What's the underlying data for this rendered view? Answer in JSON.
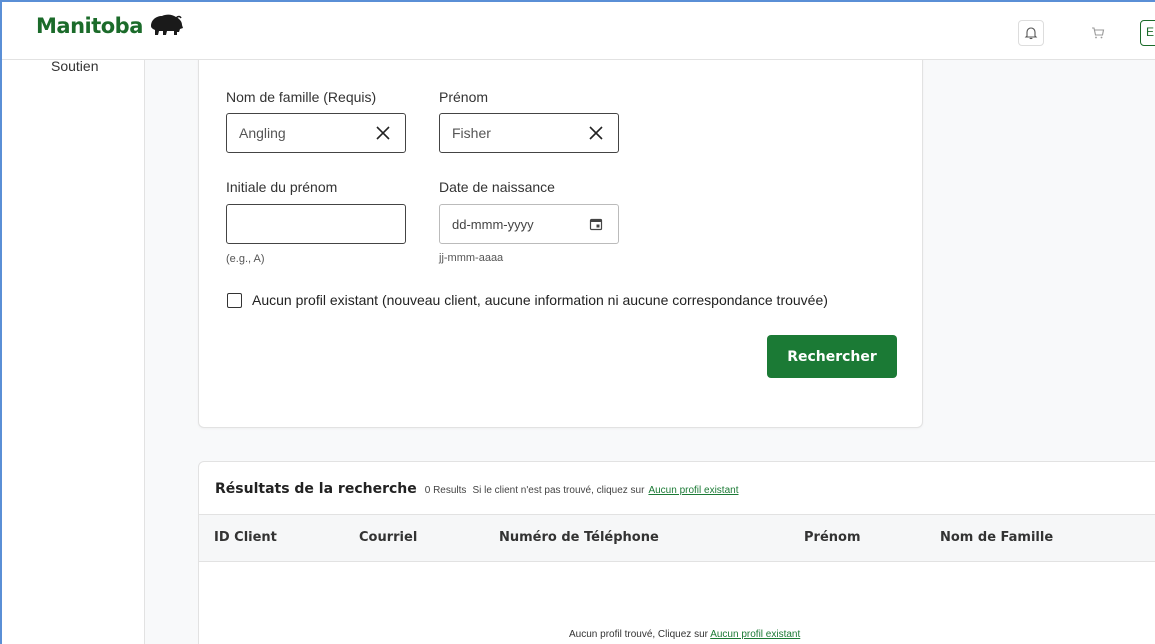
{
  "header": {
    "brand": "Manitoba",
    "lang_label": "E",
    "colors": {
      "brand": "#1b6b2a",
      "accent": "#1b7a35"
    }
  },
  "sidebar": {
    "items": [
      {
        "label": "Soutien"
      }
    ]
  },
  "form": {
    "last_name": {
      "label": "Nom de famille (Requis)",
      "value": "Angling"
    },
    "first_name": {
      "label": "Prénom",
      "value": "Fisher"
    },
    "initial": {
      "label": "Initiale du prénom",
      "value": "",
      "hint": "(e.g., A)"
    },
    "dob": {
      "label": "Date de naissance",
      "placeholder": "dd-mmm-yyyy",
      "hint": "jj-mmm-aaaa"
    },
    "no_profile_checkbox": {
      "label": "Aucun profil existant (nouveau client, aucune information ni aucune correspondance trouvée)",
      "checked": false
    },
    "search_button": "Rechercher"
  },
  "results": {
    "title": "Résultats de la recherche",
    "count": "0 Results",
    "note": "Si le client n'est pas trouvé, cliquez sur",
    "link": "Aucun profil existant",
    "columns": [
      "ID Client",
      "Courriel",
      "Numéro de Téléphone",
      "Prénom",
      "Nom de Famille"
    ],
    "empty_text": "Aucun profil trouvé, Cliquez sur",
    "empty_link": "Aucun profil existant"
  },
  "icons": {
    "bell": "bell-icon",
    "cart": "cart-icon",
    "clear": "close-icon",
    "calendar": "calendar-icon",
    "logo": "bison-logo"
  }
}
